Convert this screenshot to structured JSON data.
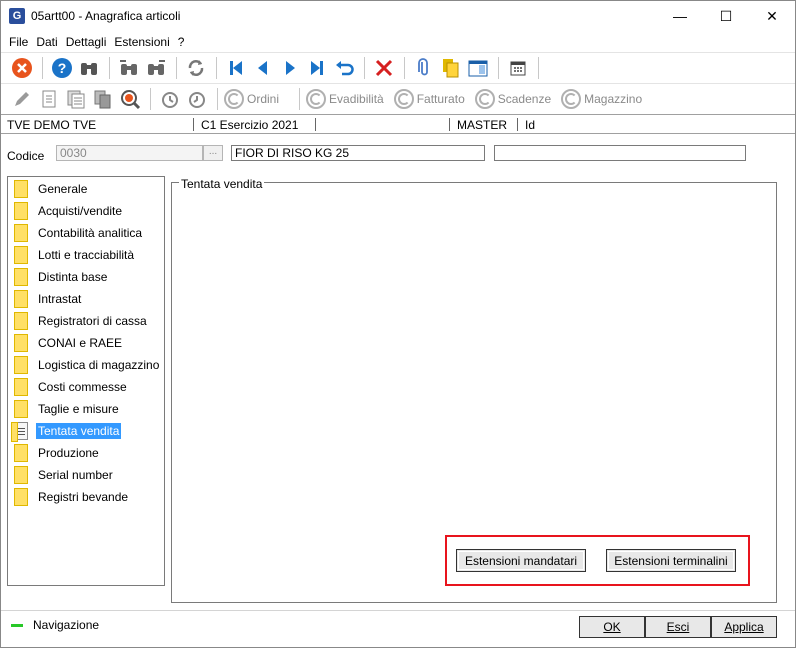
{
  "window": {
    "title": "05artt00 - Anagrafica articoli",
    "app_icon_letter": "G"
  },
  "window_controls": {
    "minimize": "—",
    "maximize": "☐",
    "close": "✕"
  },
  "menu": [
    "File",
    "Dati",
    "Dettagli",
    "Estensioni",
    "?"
  ],
  "toolbar2": {
    "labels": [
      "Ordini",
      "Evadibilità",
      "Fatturato",
      "Scadenze",
      "Magazzino"
    ]
  },
  "infostrip": {
    "company": "TVE DEMO TVE",
    "year": "C1 Esercizio 2021",
    "master": "MASTER",
    "id": "Id"
  },
  "codice": {
    "label": "Codice",
    "value": "0030",
    "dots": "...",
    "description": "FIOR DI RISO KG 25",
    "extra": ""
  },
  "nav": {
    "items": [
      "Generale",
      "Acquisti/vendite",
      "Contabilità analitica",
      "Lotti e tracciabilità",
      "Distinta base",
      "Intrastat",
      "Registratori di cassa",
      "CONAI e RAEE",
      "Logistica di magazzino",
      "Costi commesse",
      "Taglie e misure",
      "Tentata vendita",
      "Produzione",
      "Serial number",
      "Registri bevande"
    ],
    "selected": "Tentata vendita"
  },
  "panel": {
    "title": "Tentata vendita",
    "btn_mandatari": "Estensioni mandatari",
    "btn_terminalini": "Estensioni terminalini"
  },
  "status": {
    "navigazione": "Navigazione"
  },
  "footer": {
    "ok": "OK",
    "esci": "Esci",
    "applica": "Applica"
  },
  "colors": {
    "selection": "#3399ff",
    "highlight": "#e8141d",
    "status_green": "#28c828"
  }
}
